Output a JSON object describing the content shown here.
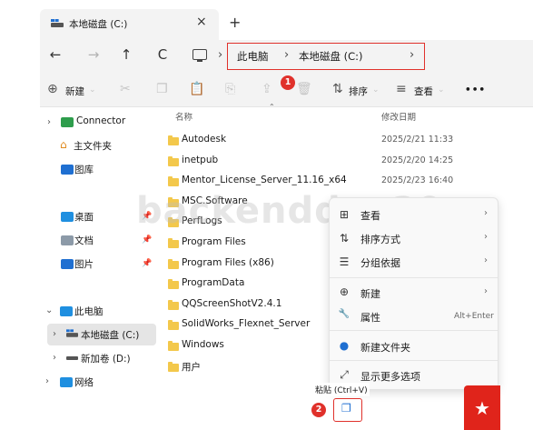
{
  "tab": {
    "title": "本地磁盘 (C:)",
    "close": "×",
    "new_tab": "+"
  },
  "nav": {
    "back": "←",
    "forward": "→",
    "up": "↑",
    "refresh": "C",
    "sep": "›"
  },
  "breadcrumb": [
    "此电脑",
    "本地磁盘 (C:)"
  ],
  "toolbar": {
    "new_label": "新建",
    "sort_label": "排序",
    "view_label": "查看",
    "more": "•••",
    "badge": "1"
  },
  "sidebar": {
    "top": [
      {
        "label": "Connector"
      },
      {
        "label": "主文件夹"
      },
      {
        "label": "图库"
      }
    ],
    "quick": [
      {
        "label": "桌面"
      },
      {
        "label": "文档"
      },
      {
        "label": "图片"
      }
    ],
    "tree": [
      {
        "label": "此电脑"
      },
      {
        "label": "本地磁盘 (C:)"
      },
      {
        "label": "新加卷 (D:)"
      },
      {
        "label": "网络"
      }
    ]
  },
  "columns": {
    "name": "名称",
    "modified": "修改日期"
  },
  "files": [
    {
      "name": "Autodesk",
      "date": "2025/2/21 11:33"
    },
    {
      "name": "inetpub",
      "date": "2025/2/20 14:25"
    },
    {
      "name": "Mentor_License_Server_11.16_x64",
      "date": "2025/2/23 16:40"
    },
    {
      "name": "MSC.Software",
      "date": ""
    },
    {
      "name": "PerfLogs",
      "date": ""
    },
    {
      "name": "Program Files",
      "date": ""
    },
    {
      "name": "Program Files (x86)",
      "date": ""
    },
    {
      "name": "ProgramData",
      "date": ""
    },
    {
      "name": "QQScreenShotV2.4.1",
      "date": ""
    },
    {
      "name": "SolidWorks_Flexnet_Server",
      "date": ""
    },
    {
      "name": "Windows",
      "date": ""
    },
    {
      "name": "用户",
      "date": ""
    }
  ],
  "context_menu": {
    "items": [
      {
        "label": "查看",
        "icon": "grid-icon",
        "glyph": "⊞"
      },
      {
        "label": "排序方式",
        "icon": "sort-icon",
        "glyph": "⇅"
      },
      {
        "label": "分组依据",
        "icon": "group-icon",
        "glyph": "☰"
      },
      {
        "label": "新建",
        "icon": "plus-circle-icon",
        "glyph": "⊕"
      },
      {
        "label": "属性",
        "icon": "wrench-icon",
        "glyph": "🔧"
      },
      {
        "label": "新建文件夹",
        "icon": "new-folder-icon",
        "glyph": "●"
      },
      {
        "label": "显示更多选项",
        "icon": "more-options-icon",
        "glyph": "⤢"
      }
    ],
    "properties_accel": "Alt+Enter",
    "arrow": "›"
  },
  "paste_tooltip": "粘贴 (Ctrl+V)",
  "paste_badge": "2",
  "watermark": "backenddev29",
  "colors": {
    "accent_red": "#e0312b",
    "folder": "#f3c84b",
    "drive_blue": "#1f6fd1",
    "connector_green": "#2e9d4c"
  }
}
